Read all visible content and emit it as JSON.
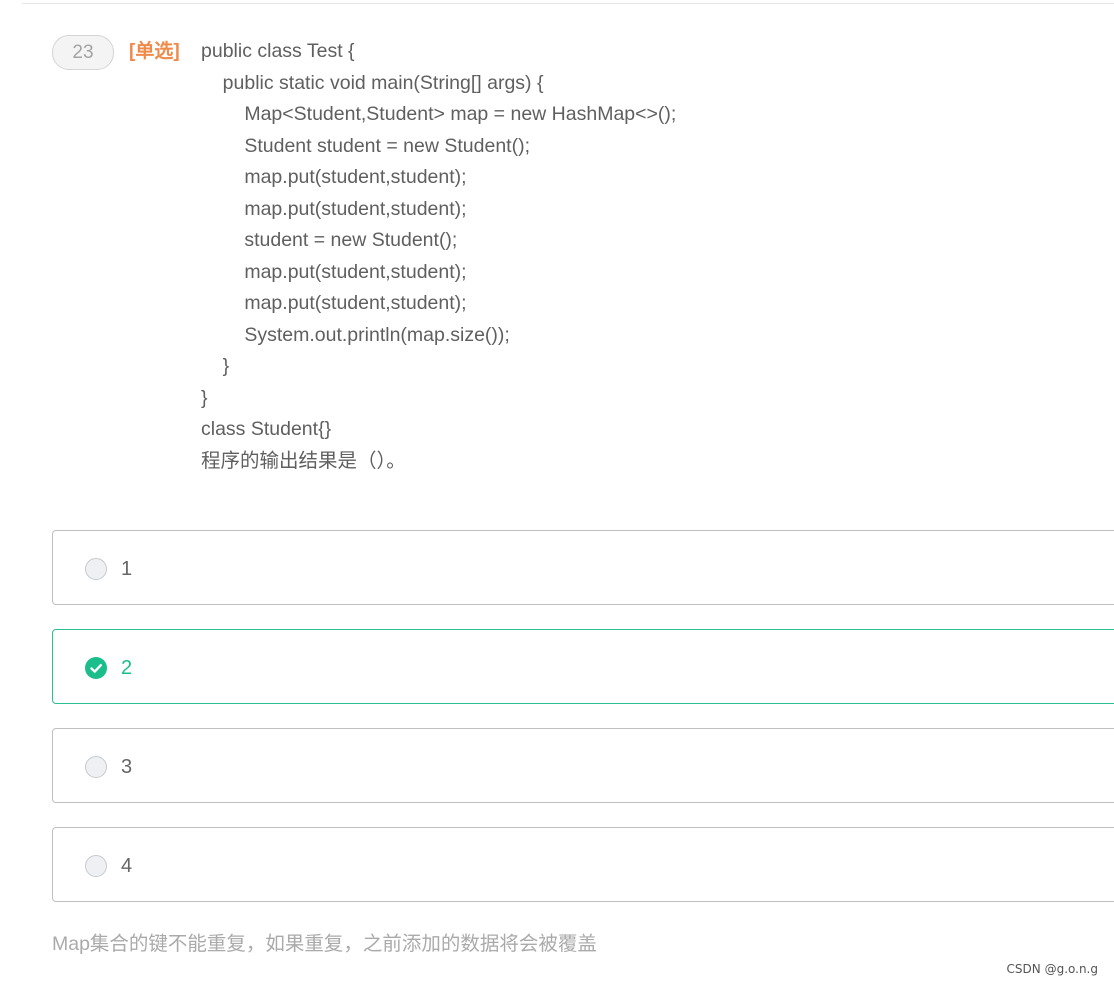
{
  "question": {
    "number": "23",
    "type_label": "[单选]",
    "code_lines": [
      "public class Test {",
      "    public static void main(String[] args) {",
      "        Map<Student,Student> map = new HashMap<>();",
      "        Student student = new Student();",
      "        map.put(student,student);",
      "        map.put(student,student);",
      "        student = new Student();",
      "        map.put(student,student);",
      "        map.put(student,student);",
      "        System.out.println(map.size());",
      "    }",
      "}",
      "class Student{}",
      "程序的输出结果是（）。"
    ]
  },
  "options": [
    {
      "label": "1",
      "selected": false
    },
    {
      "label": "2",
      "selected": true
    },
    {
      "label": "3",
      "selected": false
    },
    {
      "label": "4",
      "selected": false
    }
  ],
  "explanation": "Map集合的键不能重复，如果重复，之前添加的数据将会被覆盖",
  "watermark": "CSDN @g.o.n.g",
  "colors": {
    "type_label": "#f08a4b",
    "selected_accent": "#19be8b",
    "option_border": "#bfbfbf"
  },
  "icons": {
    "selected": "check-circle-icon",
    "unselected": "radio-empty-icon"
  }
}
